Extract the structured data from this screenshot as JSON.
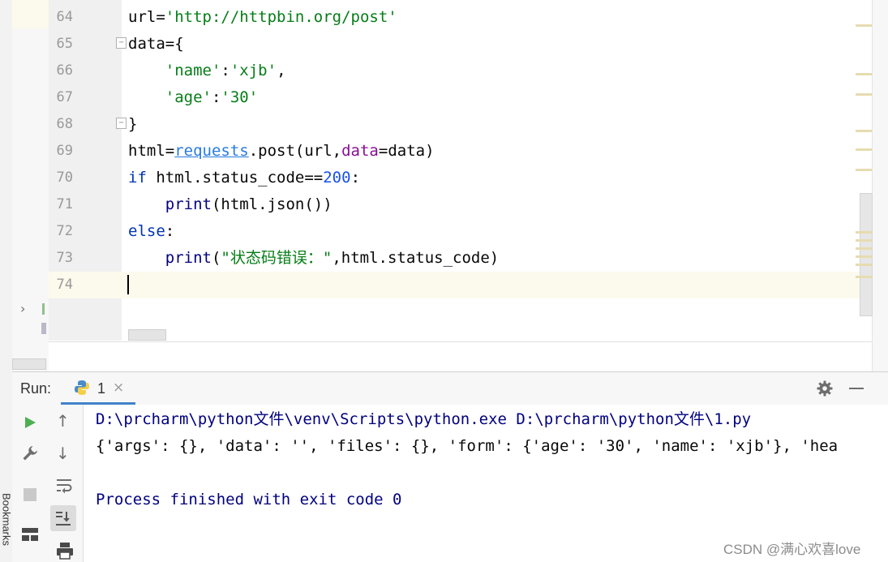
{
  "editor": {
    "line_numbers": [
      "64",
      "65",
      "66",
      "67",
      "68",
      "69",
      "70",
      "71",
      "72",
      "73",
      "74"
    ],
    "lines": {
      "l64": {
        "a": "url=",
        "b": "'http://httpbin.org/post'"
      },
      "l65": {
        "a": "data={"
      },
      "l66": {
        "a": "    ",
        "b": "'name'",
        "c": ":",
        "d": "'xjb'",
        "e": ","
      },
      "l67": {
        "a": "    ",
        "b": "'age'",
        "c": ":",
        "d": "'30'"
      },
      "l68": {
        "a": "}"
      },
      "l69": {
        "a": "html=",
        "b": "requests",
        "c": ".post(url,",
        "d": "data",
        "e": "=data)"
      },
      "l70": {
        "a": "if",
        "b": " html.status_code==",
        "c": "200",
        "d": ":"
      },
      "l71": {
        "a": "    ",
        "b": "print",
        "c": "(html.json())"
      },
      "l72": {
        "a": "else",
        "b": ":"
      },
      "l73": {
        "a": "    ",
        "b": "print",
        "c": "(",
        "d": "\"状态码错误：\"",
        "e": ",html.status_code)"
      }
    }
  },
  "run": {
    "label": "Run:",
    "tab_name": "1",
    "console": {
      "line1": "D:\\prcharm\\python文件\\venv\\Scripts\\python.exe D:\\prcharm\\python文件\\1.py",
      "line2": "{'args': {}, 'data': '', 'files': {}, 'form': {'age': '30', 'name': 'xjb'}, 'hea",
      "line3": "Process finished with exit code 0"
    }
  },
  "sidebar": {
    "bookmarks_label": "Bookmarks"
  },
  "watermark": "CSDN @满心欢喜love",
  "colors": {
    "keyword": "#0033b3",
    "string": "#067d17",
    "number": "#1750eb",
    "current_line": "#fcfaed",
    "console_text": "#000080"
  }
}
